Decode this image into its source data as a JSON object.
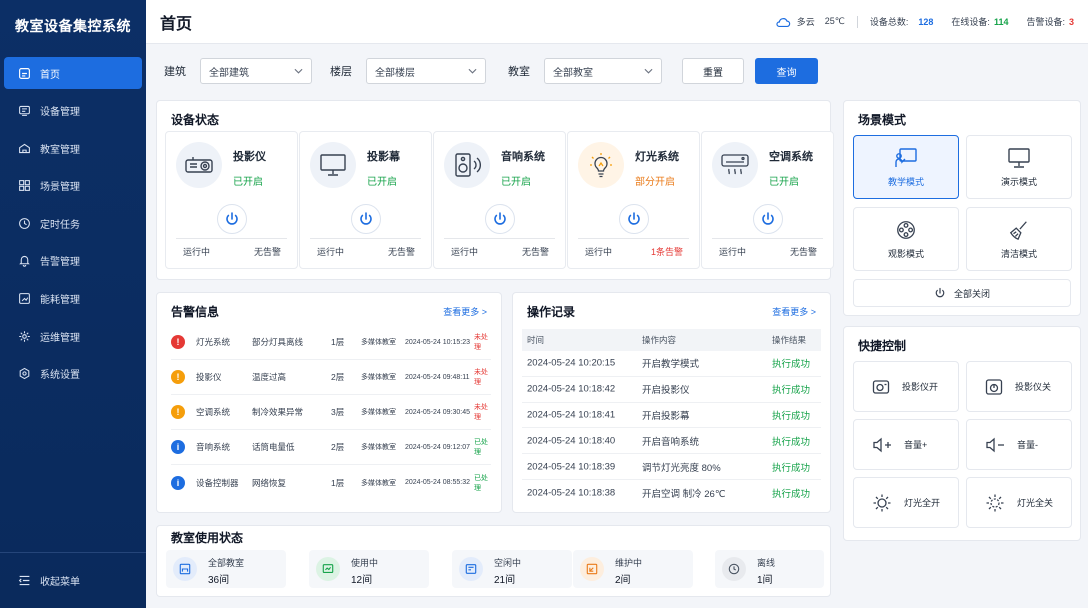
{
  "app": {
    "title": "教室设备集控系统"
  },
  "sidebar": {
    "items": [
      {
        "label": "首页",
        "icon": "home-icon"
      },
      {
        "label": "设备管理",
        "icon": "device-icon"
      },
      {
        "label": "教室管理",
        "icon": "classroom-icon"
      },
      {
        "label": "场景管理",
        "icon": "scene-icon"
      },
      {
        "label": "定时任务",
        "icon": "clock-icon"
      },
      {
        "label": "告警管理",
        "icon": "bell-icon"
      },
      {
        "label": "能耗管理",
        "icon": "energy-icon"
      },
      {
        "label": "运维管理",
        "icon": "maintenance-icon"
      },
      {
        "label": "系统设置",
        "icon": "gear-icon"
      }
    ],
    "collapse_label": "收起菜单"
  },
  "header": {
    "title": "首页",
    "weather": "多云",
    "temperature": "25℃",
    "total_label": "设备总数:",
    "total_value": "128",
    "online_label": "在线设备:",
    "online_value": "114",
    "alarm_label": "告警设备:",
    "alarm_value": "3",
    "colors": {
      "total": "#1d6de0",
      "online": "#16a34a",
      "alarm": "#e53935"
    }
  },
  "filters": {
    "building_label": "建筑",
    "building_value": "全部建筑",
    "floor_label": "楼层",
    "floor_value": "全部楼层",
    "room_label": "教室",
    "room_value": "全部教室",
    "reset_label": "重置",
    "query_label": "查询"
  },
  "device_status": {
    "title": "设备状态",
    "devices": [
      {
        "name": "投影仪",
        "status": "已开启",
        "run": "运行中",
        "alarm": "无告警",
        "icon": "projector-icon"
      },
      {
        "name": "投影幕",
        "status": "已开启",
        "run": "运行中",
        "alarm": "无告警",
        "icon": "screen-icon"
      },
      {
        "name": "音响系统",
        "status": "已开启",
        "run": "运行中",
        "alarm": "无告警",
        "icon": "speaker-icon"
      },
      {
        "name": "灯光系统",
        "status": "部分开启",
        "run": "运行中",
        "alarm": "1条告警",
        "icon": "bulb-icon"
      },
      {
        "name": "空调系统",
        "status": "已开启",
        "run": "运行中",
        "alarm": "无告警",
        "icon": "ac-icon"
      }
    ]
  },
  "scenes": {
    "title": "场景模式",
    "items": [
      {
        "label": "教学模式",
        "icon": "teaching-icon"
      },
      {
        "label": "演示模式",
        "icon": "monitor-icon"
      },
      {
        "label": "观影模式",
        "icon": "film-reel-icon"
      },
      {
        "label": "清洁模式",
        "icon": "broom-icon"
      }
    ],
    "all_off_label": "全部关闭"
  },
  "quick": {
    "title": "快捷控制",
    "items": [
      {
        "label": "投影仪开",
        "icon": "projector-on-icon"
      },
      {
        "label": "投影仪关",
        "icon": "projector-off-icon"
      },
      {
        "label": "音量+",
        "icon": "volume-up-icon"
      },
      {
        "label": "音量-",
        "icon": "volume-down-icon"
      },
      {
        "label": "灯光全开",
        "icon": "light-on-icon"
      },
      {
        "label": "灯光全关",
        "icon": "light-off-icon"
      }
    ]
  },
  "alarms": {
    "title": "告警信息",
    "more": "查看更多 >",
    "rows": [
      {
        "level": "red",
        "glyph": "!",
        "device": "灯光系统",
        "desc": "部分灯具离线",
        "floor": "1层",
        "room": "多媒体教室",
        "time": "2024-05-24 10:15:23",
        "state": "未处理",
        "state_color": "red"
      },
      {
        "level": "orange",
        "glyph": "!",
        "device": "投影仪",
        "desc": "温度过高",
        "floor": "2层",
        "room": "多媒体教室",
        "time": "2024-05-24 09:48:11",
        "state": "未处理",
        "state_color": "red"
      },
      {
        "level": "orange",
        "glyph": "!",
        "device": "空调系统",
        "desc": "制冷效果异常",
        "floor": "3层",
        "room": "多媒体教室",
        "time": "2024-05-24 09:30:45",
        "state": "未处理",
        "state_color": "red"
      },
      {
        "level": "blue",
        "glyph": "i",
        "device": "音响系统",
        "desc": "话筒电量低",
        "floor": "2层",
        "room": "多媒体教室",
        "time": "2024-05-24 09:12:07",
        "state": "已处理",
        "state_color": "green"
      },
      {
        "level": "blue",
        "glyph": "i",
        "device": "设备控制器",
        "desc": "网络恢复",
        "floor": "1层",
        "room": "多媒体教室",
        "time": "2024-05-24 08:55:32",
        "state": "已处理",
        "state_color": "green"
      }
    ]
  },
  "logs": {
    "title": "操作记录",
    "more": "查看更多 >",
    "headers": {
      "time": "时间",
      "content": "操作内容",
      "result": "操作结果"
    },
    "rows": [
      {
        "time": "2024-05-24 10:20:15",
        "content": "开启教学模式",
        "result": "执行成功"
      },
      {
        "time": "2024-05-24 10:18:42",
        "content": "开启投影仪",
        "result": "执行成功"
      },
      {
        "time": "2024-05-24 10:18:41",
        "content": "开启投影幕",
        "result": "执行成功"
      },
      {
        "time": "2024-05-24 10:18:40",
        "content": "开启音响系统",
        "result": "执行成功"
      },
      {
        "time": "2024-05-24 10:18:39",
        "content": "调节灯光亮度 80%",
        "result": "执行成功"
      },
      {
        "time": "2024-05-24 10:18:38",
        "content": "开启空调 制冷 26℃",
        "result": "执行成功"
      }
    ]
  },
  "usage": {
    "title": "教室使用状态",
    "items": [
      {
        "label": "全部教室",
        "value": "36间",
        "icon": "classroom-icon",
        "color": "#1d6de0",
        "bg": "#e3ecfb"
      },
      {
        "label": "使用中",
        "value": "12间",
        "icon": "in-use-icon",
        "color": "#16a34a",
        "bg": "#dcf3e4"
      },
      {
        "label": "空闲中",
        "value": "21间",
        "icon": "idle-icon",
        "color": "#1d6de0",
        "bg": "#e3ecfb"
      },
      {
        "label": "维护中",
        "value": "2间",
        "icon": "maintenance-icon",
        "color": "#ea7b1a",
        "bg": "#fdeede"
      },
      {
        "label": "离线",
        "value": "1间",
        "icon": "offline-icon",
        "color": "#6b7280",
        "bg": "#e8eaee"
      }
    ]
  }
}
